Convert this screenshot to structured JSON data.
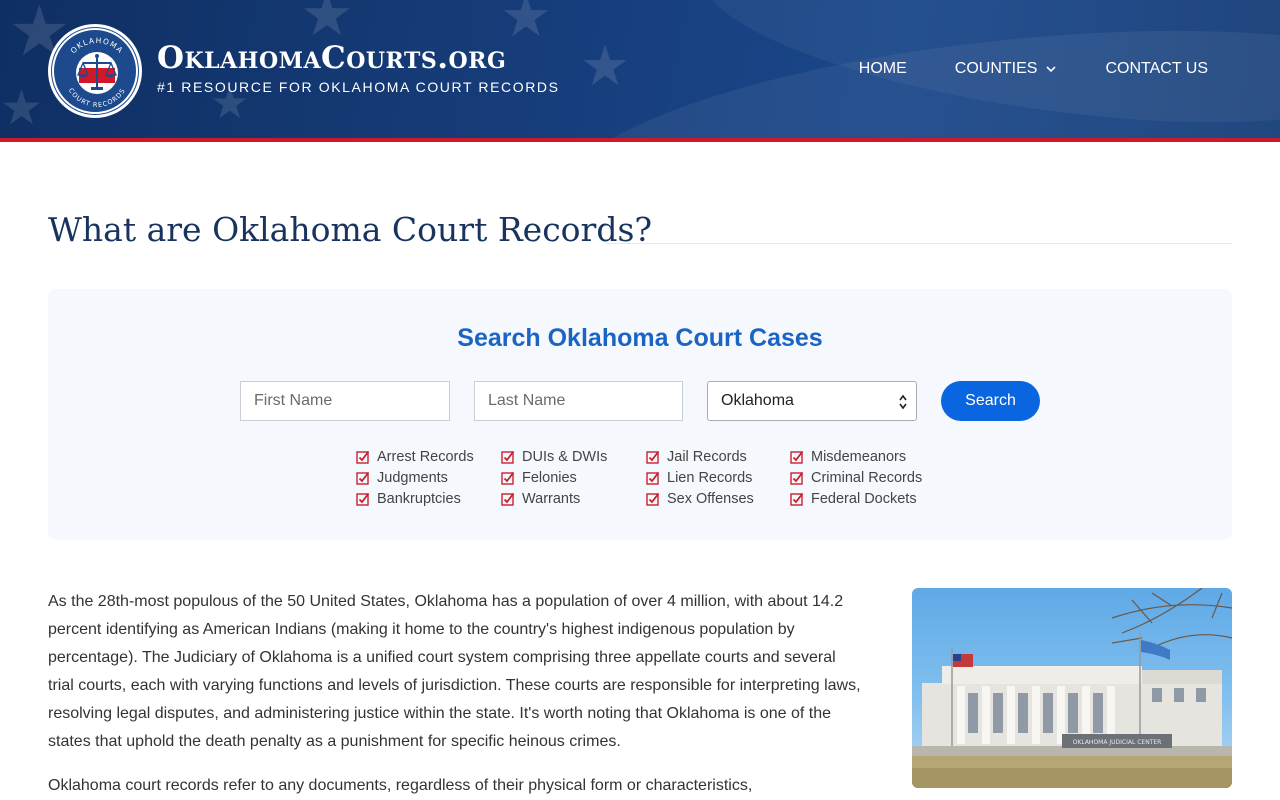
{
  "site": {
    "name": "OklahomaCourts.org",
    "tagline": "#1 RESOURCE FOR OKLAHOMA COURT RECORDS",
    "seal_text_top": "OKLAHOMA",
    "seal_text_bottom": "COURT RECORDS"
  },
  "nav": {
    "items": [
      {
        "label": "HOME"
      },
      {
        "label": "COUNTIES",
        "icon": "chevron-down-icon"
      },
      {
        "label": "CONTACT US"
      }
    ]
  },
  "page": {
    "title": "What are Oklahoma Court Records?"
  },
  "search": {
    "title": "Search Oklahoma Court Cases",
    "first_name_placeholder": "First Name",
    "last_name_placeholder": "Last Name",
    "state_value": "Oklahoma",
    "button_label": "Search",
    "record_types": [
      [
        "Arrest Records",
        "Judgments",
        "Bankruptcies"
      ],
      [
        "DUIs & DWIs",
        "Felonies",
        "Warrants"
      ],
      [
        "Jail Records",
        "Lien Records",
        "Sex Offenses"
      ],
      [
        "Misdemeanors",
        "Criminal Records",
        "Federal Dockets"
      ]
    ]
  },
  "article": {
    "paragraphs": [
      "As the 28th-most populous of the 50 United States, Oklahoma has a population of over 4 million, with about 14.2 percent identifying as American Indians (making it home to the country's highest indigenous population by percentage). The Judiciary of Oklahoma is a unified court system comprising three appellate courts and several trial courts, each with varying functions and levels of jurisdiction. These courts are responsible for interpreting laws, resolving legal disputes, and administering justice within the state. It's worth noting that Oklahoma is one of the states that uphold the death penalty as a punishment for specific heinous crimes.",
      "Oklahoma court records refer to any documents, regardless of their physical form or characteristics,"
    ],
    "image_sign_text": "OKLAHOMA JUDICIAL CENTER"
  },
  "colors": {
    "header_blue": "#173e7c",
    "accent_red": "#d0182b",
    "title_blue": "#17335e",
    "search_title_blue": "#1a64c3",
    "button_blue": "#0a66e0",
    "check_red": "#c8202e"
  }
}
